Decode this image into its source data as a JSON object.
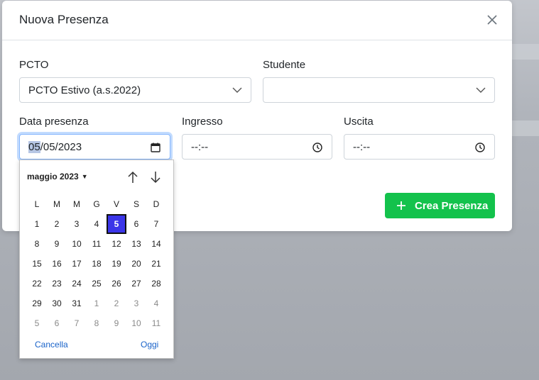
{
  "modal": {
    "title": "Nuova Presenza"
  },
  "form": {
    "pcto_label": "PCTO",
    "pcto_value": "PCTO Estivo (a.s.2022)",
    "studente_label": "Studente",
    "studente_value": "",
    "data_label": "Data presenza",
    "data_day_selected": "05",
    "data_rest": "/05/2023",
    "ingresso_label": "Ingresso",
    "ingresso_value": "--:--",
    "uscita_label": "Uscita",
    "uscita_value": "--:--"
  },
  "actions": {
    "create_label": "Crea Presenza"
  },
  "picker": {
    "month_label": "maggio 2023",
    "weekdays": [
      "L",
      "M",
      "M",
      "G",
      "V",
      "S",
      "D"
    ],
    "weeks": [
      [
        "1",
        "2",
        "3",
        "4",
        "5",
        "6",
        "7"
      ],
      [
        "8",
        "9",
        "10",
        "11",
        "12",
        "13",
        "14"
      ],
      [
        "15",
        "16",
        "17",
        "18",
        "19",
        "20",
        "21"
      ],
      [
        "22",
        "23",
        "24",
        "25",
        "26",
        "27",
        "28"
      ],
      [
        "29",
        "30",
        "31",
        "1",
        "2",
        "3",
        "4"
      ],
      [
        "5",
        "6",
        "7",
        "8",
        "9",
        "10",
        "11"
      ]
    ],
    "selected_day": "5",
    "cancel_label": "Cancella",
    "today_label": "Oggi"
  },
  "icons": {
    "close": "close-icon",
    "chevron": "chevron-down-icon",
    "calendar": "calendar-icon",
    "clock": "clock-icon",
    "plus": "plus-icon",
    "up": "arrow-up-icon",
    "down": "arrow-down-icon"
  },
  "colors": {
    "accent_green": "#13c24c",
    "selected_day": "#3b35e8",
    "link_blue": "#1a63c9"
  }
}
